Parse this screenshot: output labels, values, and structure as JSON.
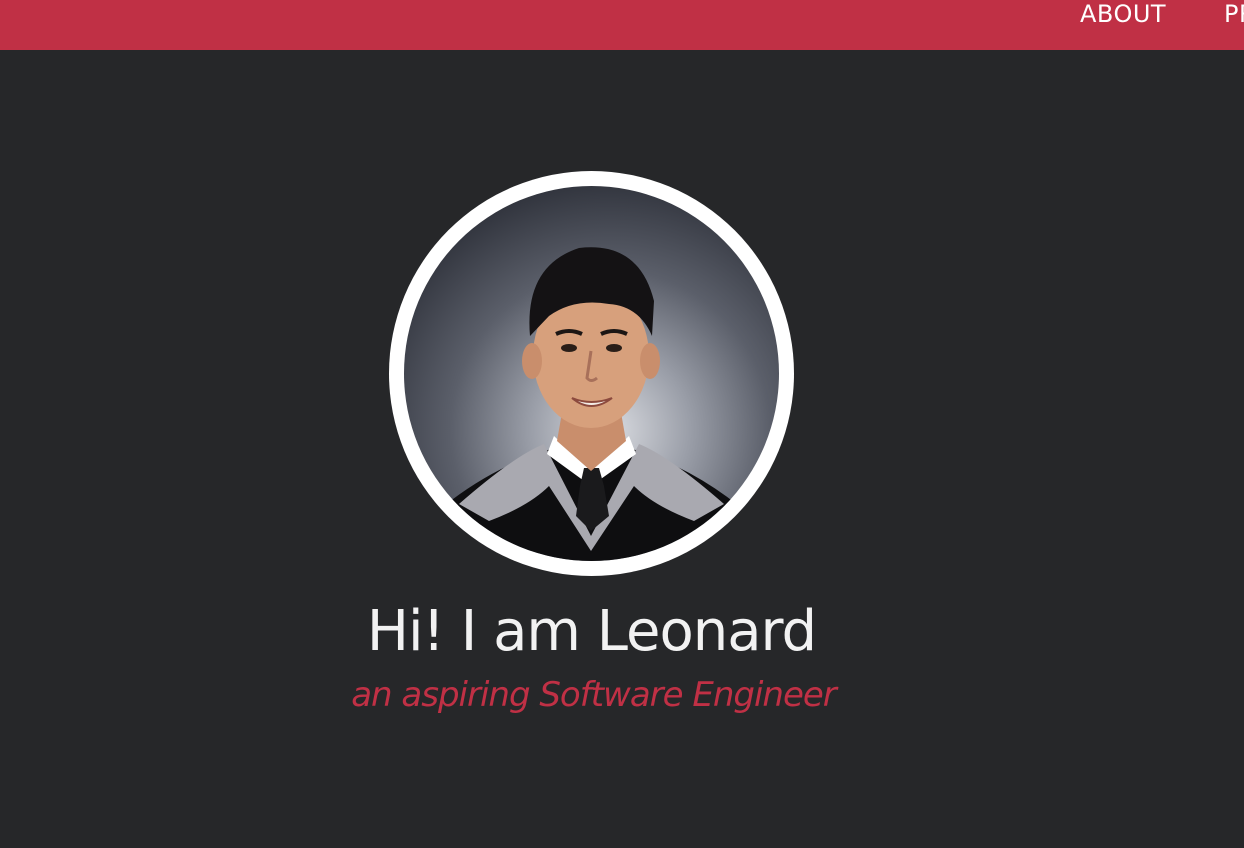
{
  "colors": {
    "navbar_bg": "#c03045",
    "page_bg": "#262729",
    "accent": "#c03045",
    "heading_text": "#f2f2f2",
    "ring": "#ffffff"
  },
  "nav": {
    "items": [
      {
        "label": "ABOUT"
      },
      {
        "label": "PROJECTS"
      }
    ]
  },
  "hero": {
    "photo_icon": "profile-photo",
    "greeting": "Hi! I am Leonard",
    "tagline": "an aspiring Software Engineer"
  }
}
